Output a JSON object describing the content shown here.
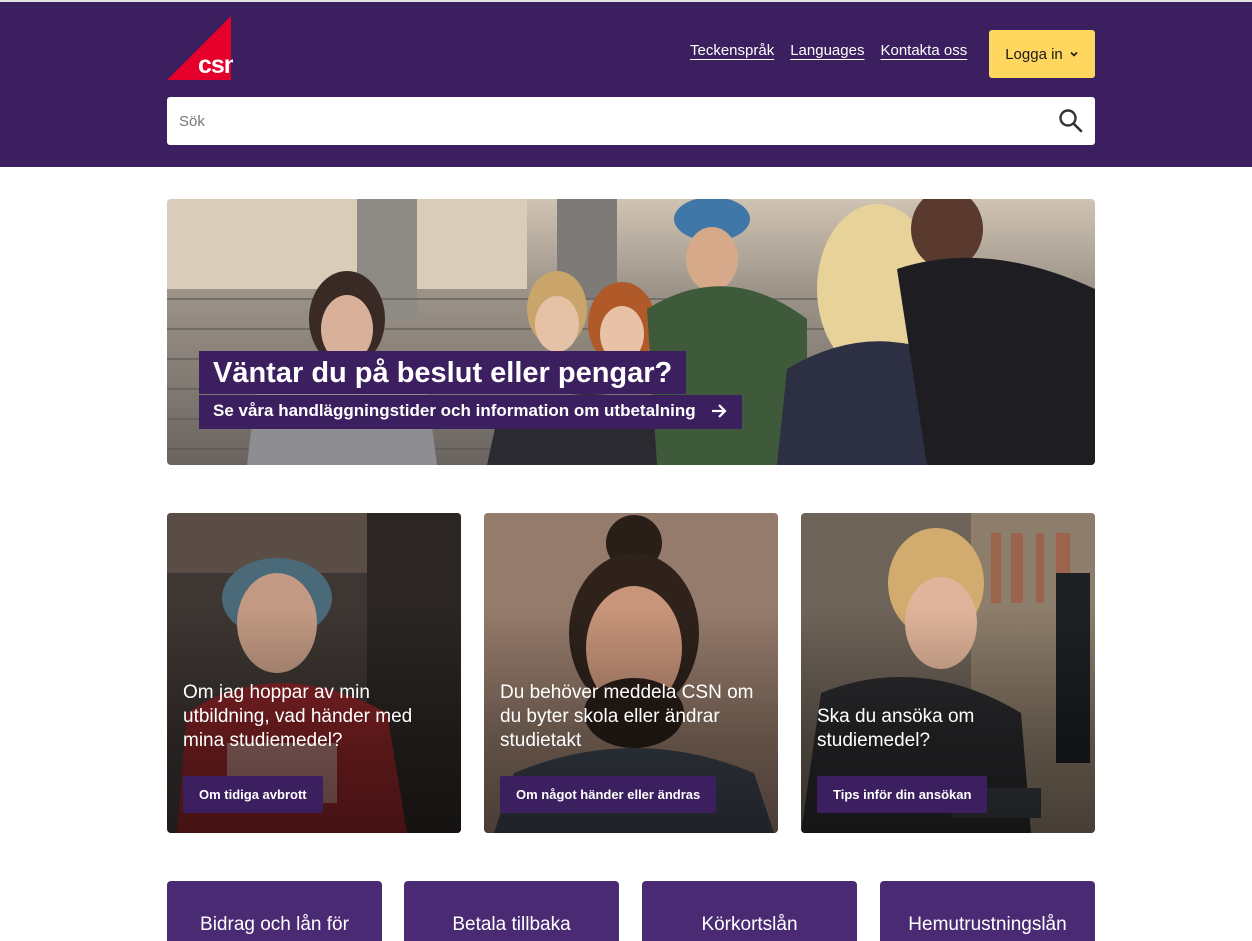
{
  "header": {
    "logo_text": "csn",
    "links": [
      "Teckenspråk",
      "Languages",
      "Kontakta oss"
    ],
    "login_label": "Logga in",
    "search_placeholder": "Sök"
  },
  "hero": {
    "title": "Väntar du på beslut eller pengar?",
    "link_text": "Se våra handläggningstider och information om utbetalning"
  },
  "cards": [
    {
      "text": "Om jag hoppar av min utbildning, vad händer med mina studiemedel?",
      "button": "Om tidiga avbrott"
    },
    {
      "text": "Du behöver meddela CSN om du byter skola eller ändrar studietakt",
      "button": "Om något händer eller ändras"
    },
    {
      "text": "Ska du ansöka om studiemedel?",
      "button": "Tips inför din ansökan"
    }
  ],
  "tiles": [
    "Bidrag och lån för",
    "Betala tillbaka",
    "Körkortslån",
    "Hemutrustningslån"
  ],
  "colors": {
    "brand_purple": "#3b1f5e",
    "login_yellow": "#ffd65e",
    "logo_red": "#e4002b",
    "tile_purple": "#4a2a72"
  }
}
